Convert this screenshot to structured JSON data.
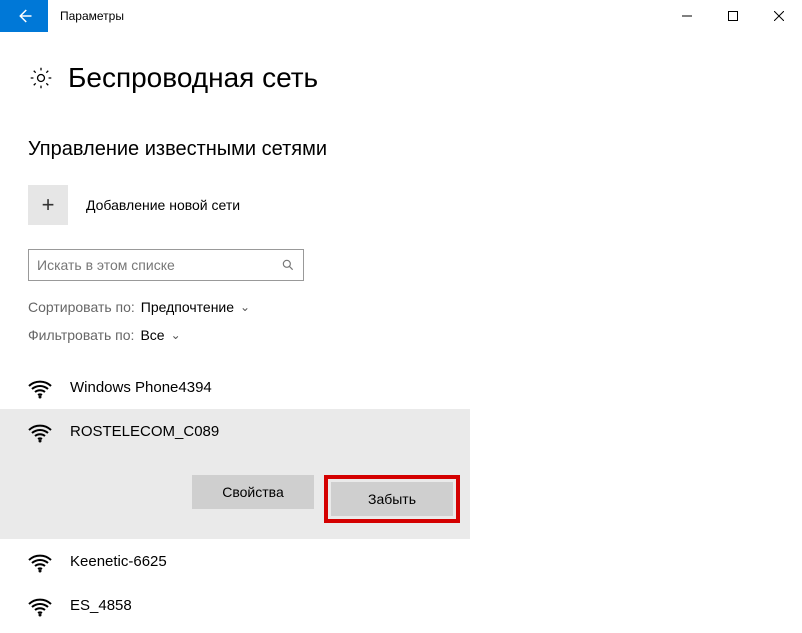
{
  "titlebar": {
    "title": "Параметры"
  },
  "page": {
    "title": "Беспроводная сеть",
    "section": "Управление известными сетями",
    "add_label": "Добавление новой сети"
  },
  "search": {
    "placeholder": "Искать в этом списке"
  },
  "filters": {
    "sort_label": "Сортировать по:",
    "sort_value": "Предпочтение",
    "filter_label": "Фильтровать по:",
    "filter_value": "Все"
  },
  "networks": [
    {
      "name": "Windows Phone4394"
    },
    {
      "name": "ROSTELECOM_C089",
      "selected": true
    },
    {
      "name": "Keenetic-6625"
    },
    {
      "name": "ES_4858"
    }
  ],
  "actions": {
    "properties": "Свойства",
    "forget": "Забыть"
  }
}
